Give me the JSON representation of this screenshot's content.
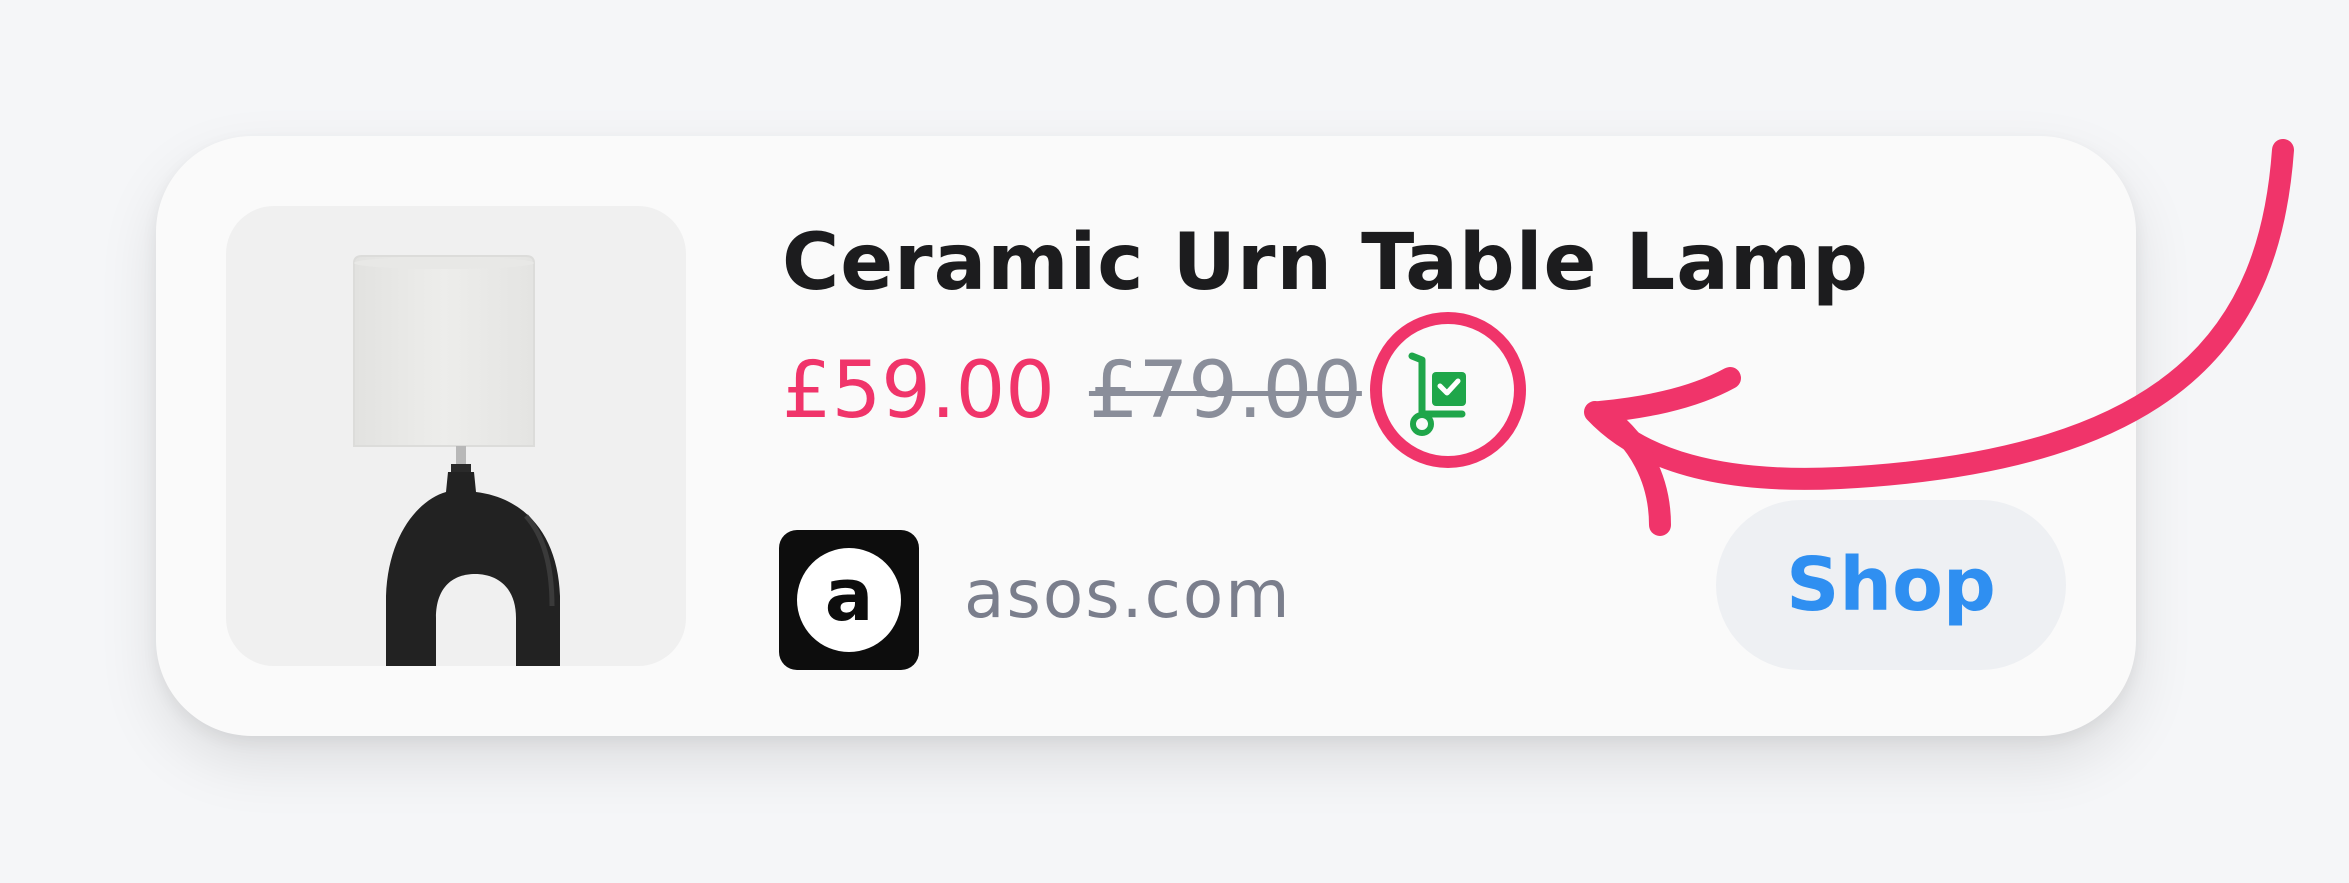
{
  "product": {
    "title": "Ceramic Urn Table Lamp",
    "price_current": "£59.00",
    "price_original": "£79.00",
    "image_icon": "table-lamp-image",
    "price_drop_icon": "cart-check-icon"
  },
  "store": {
    "logo_letter": "a",
    "domain": "asos.com"
  },
  "actions": {
    "shop_label": "Shop"
  },
  "colors": {
    "price_current": "#f0346a",
    "price_original": "#8a8e9a",
    "cart_icon": "#1fa64a",
    "annotation": "#f0346a",
    "shop_text": "#2f8ff1",
    "shop_bg": "#eef0f3"
  }
}
